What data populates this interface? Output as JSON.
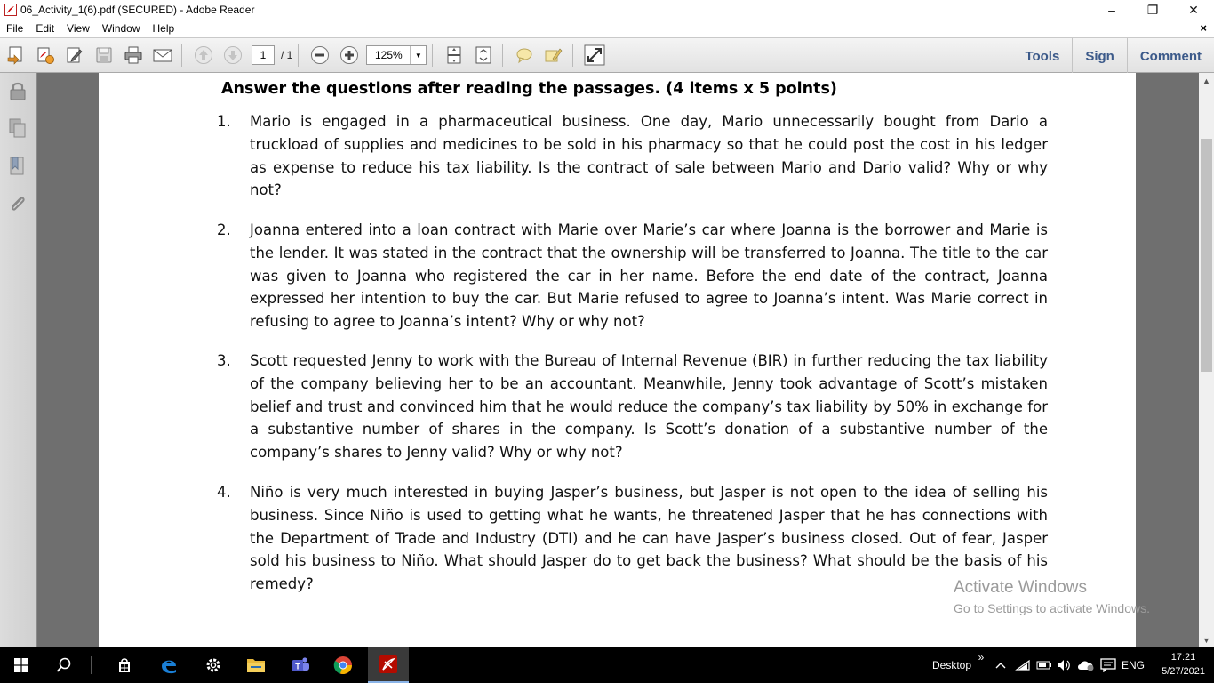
{
  "window": {
    "title": "06_Activity_1(6).pdf (SECURED) - Adobe Reader",
    "minimize": "–",
    "restore": "❐",
    "close": "✕"
  },
  "menu": {
    "items": [
      "File",
      "Edit",
      "View",
      "Window",
      "Help"
    ],
    "close_doc": "×"
  },
  "toolbar": {
    "page_current": "1",
    "page_total": "/ 1",
    "zoom": "125%",
    "links": [
      "Tools",
      "Sign",
      "Comment"
    ]
  },
  "document": {
    "heading": "Answer the questions after reading the passages. (4 items x 5 points)",
    "questions": [
      {
        "number": "1.",
        "text": "Mario is engaged in a pharmaceutical business. One day, Mario unnecessarily bought from Dario a truckload of supplies and medicines to be sold in his pharmacy so that he could post the cost in his ledger as expense to reduce his tax liability. Is the contract of sale between Mario and Dario valid? Why or why not?"
      },
      {
        "number": "2.",
        "text": "Joanna entered into a loan contract with Marie over Marie’s car where Joanna is the borrower and Marie is the lender. It was stated in the contract that the ownership will be transferred to Joanna. The title to the car was given to Joanna who registered the car in her name. Before the end date of the contract, Joanna expressed her intention to buy the car. But Marie refused to agree to Joanna’s intent. Was Marie correct in refusing to agree to Joanna’s intent? Why or why not?"
      },
      {
        "number": "3.",
        "text": "Scott requested Jenny to work with the Bureau of Internal Revenue (BIR) in further reducing the tax liability of the company believing her to be an accountant. Meanwhile, Jenny took advantage of Scott’s mistaken belief and trust and convinced him that he would reduce the company’s tax liability by 50% in exchange for a substantive number of shares in the company. Is Scott’s donation of a substantive number of the company’s shares to Jenny valid? Why or why not?"
      },
      {
        "number": "4.",
        "text": "Niño is very much interested in buying Jasper’s business, but Jasper is not open to the idea of selling his business. Since Niño is used to getting what he wants, he threatened Jasper that he has connections with the Department of Trade and Industry (DTI) and he can have Jasper’s business closed. Out of fear, Jasper sold his business to Niño. What should Jasper do to get back the business? What should be the basis of his remedy?"
      }
    ]
  },
  "watermark": {
    "line1": "Activate Windows",
    "line2": "Go to Settings to activate Windows."
  },
  "taskbar": {
    "desktop_label": "Desktop",
    "chevron": "»",
    "language": "ENG",
    "time": "17:21",
    "date": "5/27/2021"
  }
}
